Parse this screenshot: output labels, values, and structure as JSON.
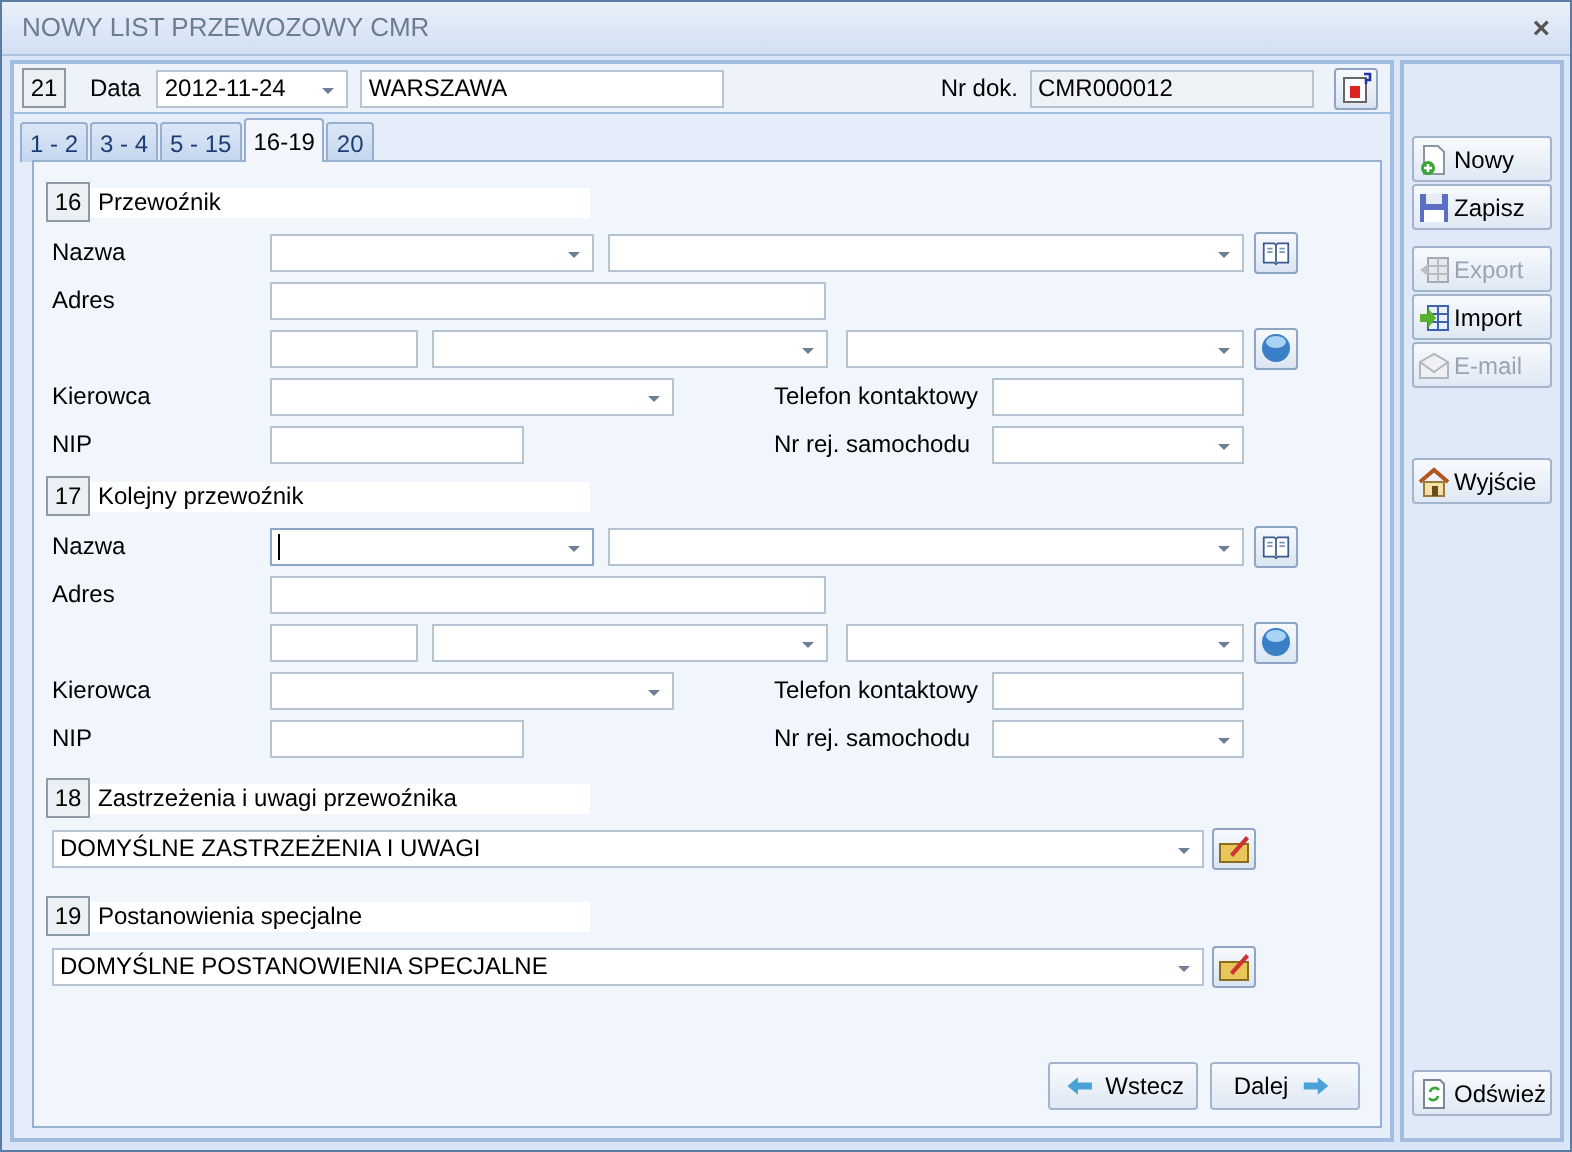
{
  "window": {
    "title": "NOWY LIST PRZEWOZOWY CMR",
    "close": "×"
  },
  "header": {
    "number": "21",
    "date_label": "Data",
    "date_value": "2012-11-24",
    "place_value": "WARSZAWA",
    "doc_label": "Nr dok.",
    "doc_value": "CMR000012"
  },
  "tabs": [
    {
      "label": "1 - 2",
      "selected": false
    },
    {
      "label": "3 - 4",
      "selected": false
    },
    {
      "label": "5 - 15",
      "selected": false
    },
    {
      "label": "16-19",
      "selected": true
    },
    {
      "label": "20",
      "selected": false
    }
  ],
  "sections": [
    {
      "kind": "carrier",
      "number": "16",
      "title": "Przewoźnik",
      "name_label": "Nazwa",
      "address_label": "Adres",
      "driver_label": "Kierowca",
      "phone_label": "Telefon kontaktowy",
      "nip_label": "NIP",
      "plate_label": "Nr rej. samochodu",
      "name_focused": false
    },
    {
      "kind": "carrier",
      "number": "17",
      "title": "Kolejny przewoźnik",
      "name_label": "Nazwa",
      "address_label": "Adres",
      "driver_label": "Kierowca",
      "phone_label": "Telefon kontaktowy",
      "nip_label": "NIP",
      "plate_label": "Nr rej. samochodu",
      "name_focused": true
    },
    {
      "kind": "text",
      "number": "18",
      "title": "Zastrzeżenia i uwagi przewoźnika",
      "value": "DOMYŚLNE ZASTRZEŻENIA I UWAGI"
    },
    {
      "kind": "text",
      "number": "19",
      "title": "Postanowienia specjalne",
      "value": "DOMYŚLNE POSTANOWIENIA SPECJALNE"
    }
  ],
  "nav_buttons": [
    {
      "kind": "back",
      "label": "Wstecz"
    },
    {
      "kind": "next",
      "label": "Dalej"
    }
  ],
  "sidebar": {
    "groups": [
      [
        {
          "kind": "new",
          "label": "Nowy",
          "disabled": false
        },
        {
          "kind": "save",
          "label": "Zapisz",
          "disabled": false
        }
      ],
      [
        {
          "kind": "export",
          "label": "Export",
          "disabled": true
        },
        {
          "kind": "import",
          "label": "Import",
          "disabled": false
        },
        {
          "kind": "email",
          "label": "E-mail",
          "disabled": true
        }
      ],
      [
        {
          "kind": "exit",
          "label": "Wyjście",
          "disabled": false
        }
      ]
    ],
    "bottom": [
      {
        "kind": "refresh",
        "label": "Odśwież",
        "disabled": false
      }
    ]
  }
}
